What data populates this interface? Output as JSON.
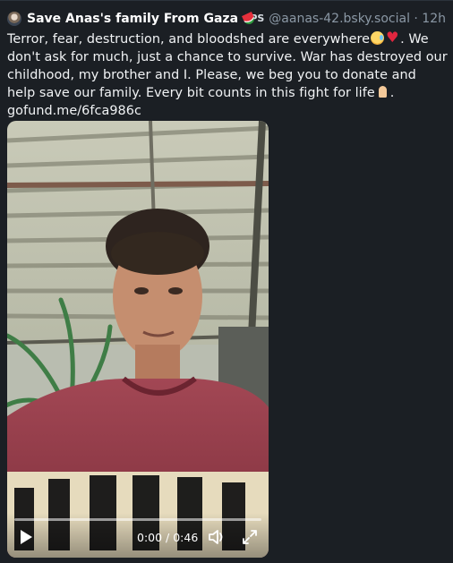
{
  "post": {
    "display_name": "Save Anas's family From Gaza",
    "flag_emoji_icon": "watermelon-icon",
    "country_code": "PS",
    "handle_and_time": "@aanas-42.bsky.social · 12h",
    "text_part1": "Terror, fear, destruction, and bloodshed are everywhere",
    "text_part2": ". We don't ask for much, just a chance to survive. War has destroyed our childhood, my brother and I. Please, we beg you to donate and help save our family. Every bit counts in this fight for life",
    "text_part3": ".",
    "link": "gofund.me/6fca986c"
  },
  "video": {
    "current_time": "0:00",
    "duration": "0:46",
    "time_display": "0:00 / 0:46",
    "progress": 0
  },
  "colors": {
    "background": "#1b1f24",
    "text": "#f1f3f5",
    "muted": "#8b98a5"
  }
}
